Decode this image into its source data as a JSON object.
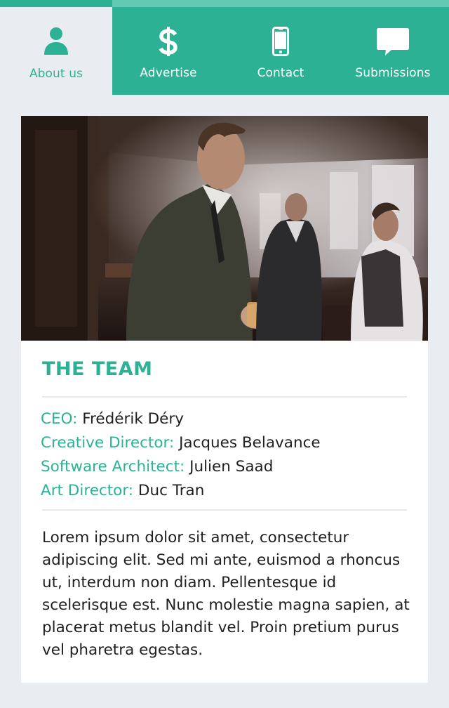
{
  "nav": {
    "items": [
      {
        "label": "About us",
        "icon": "user-icon",
        "active": true
      },
      {
        "label": "Advertise",
        "icon": "dollar-icon",
        "active": false
      },
      {
        "label": "Contact",
        "icon": "phone-icon",
        "active": false
      },
      {
        "label": "Submissions",
        "icon": "chat-bubble-icon",
        "active": false
      }
    ]
  },
  "card": {
    "title": "THE TEAM",
    "team": [
      {
        "role": "CEO:",
        "name": "Frédérik Déry"
      },
      {
        "role": "Creative Director:",
        "name": "Jacques Belavance"
      },
      {
        "role": "Software Architect:",
        "name": "Julien Saad"
      },
      {
        "role": "Art Director:",
        "name": "Duc Tran"
      }
    ],
    "description": "Lorem ipsum dolor sit amet, consectetur adipiscing elit. Sed mi ante, euismod a rhoncus ut, interdum non diam. Pellentesque id scelerisque est. Nunc molestie magna sapien, at placerat metus blandit vel. Proin pretium purus vel pharetra egestas."
  },
  "colors": {
    "accent": "#2db195",
    "accent_light": "#63c9b3",
    "background": "#e9edf1",
    "card": "#ffffff",
    "text": "#1f1f1f"
  }
}
